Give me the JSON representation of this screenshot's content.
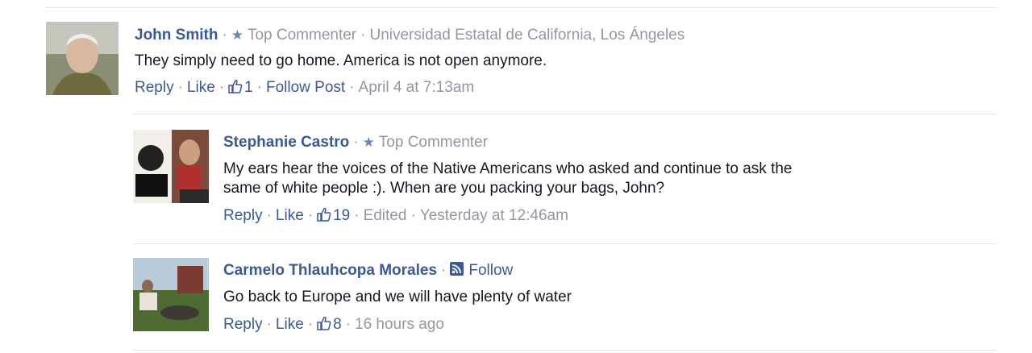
{
  "comments": [
    {
      "author": "John Smith",
      "badge": "Top Commenter",
      "affiliation": "Universidad Estatal de California, Los Ángeles",
      "text": "They simply need to go home. America is not open anymore.",
      "reply_label": "Reply",
      "like_label": "Like",
      "like_count": "1",
      "follow_post_label": "Follow Post",
      "timestamp": "April 4 at 7:13am"
    },
    {
      "author": "Stephanie Castro",
      "badge": "Top Commenter",
      "text_line1": "My ears hear the voices of the Native Americans who asked and continue to ask the",
      "text_line2": "same of white people :). When are you packing your bags, John?",
      "reply_label": "Reply",
      "like_label": "Like",
      "like_count": "19",
      "edited_label": "Edited",
      "timestamp": "Yesterday at 12:46am"
    },
    {
      "author": "Carmelo Thlauhcopa Morales",
      "follow_label": "Follow",
      "text": "Go back to Europe and we will have plenty of water",
      "reply_label": "Reply",
      "like_label": "Like",
      "like_count": "8",
      "timestamp": "16 hours ago"
    }
  ],
  "icons": {
    "star": "star-icon",
    "thumb": "thumbs-up-icon",
    "rss": "rss-icon"
  },
  "colors": {
    "link": "#3b5998",
    "meta": "#9197a3",
    "text": "#141823",
    "divider": "#e5e6e9"
  }
}
